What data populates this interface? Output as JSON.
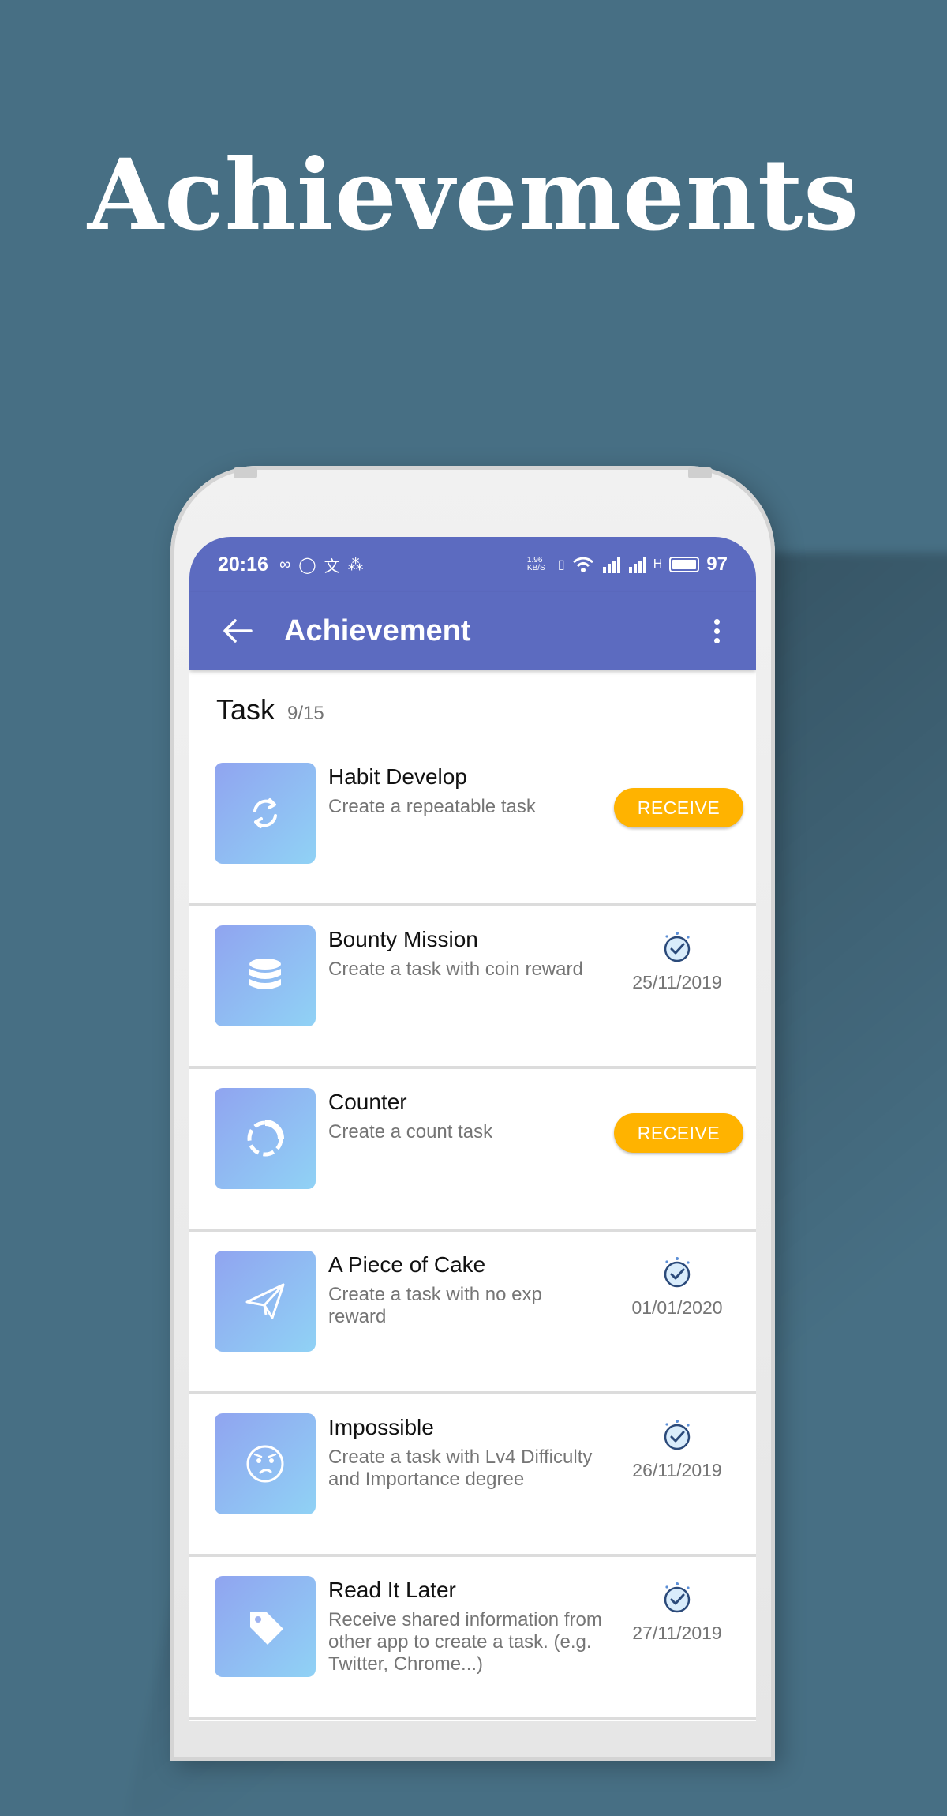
{
  "headline": "Achievements",
  "status_bar": {
    "time": "20:16",
    "net_speed": "1.96 KB/S",
    "battery": "97"
  },
  "app_bar": {
    "title": "Achievement"
  },
  "section": {
    "label": "Task",
    "count": "9/15"
  },
  "colors": {
    "background": "#476f84",
    "accent": "#5c6bc0",
    "receive_button": "#ffb300"
  },
  "items": [
    {
      "name": "Habit Develop",
      "desc": "Create a repeatable task",
      "action": "RECEIVE",
      "icon": "repeat-icon"
    },
    {
      "name": "Bounty Mission",
      "desc": "Create a task with coin reward",
      "date": "25/11/2019",
      "icon": "coins-icon"
    },
    {
      "name": "Counter",
      "desc": "Create a count task",
      "action": "RECEIVE",
      "icon": "counter-ring-icon"
    },
    {
      "name": "A Piece of Cake",
      "desc": "Create a task with no exp reward",
      "date": "01/01/2020",
      "icon": "paper-plane-icon"
    },
    {
      "name": "Impossible",
      "desc": "Create a task with Lv4 Difficulty and Importance degree",
      "date": "26/11/2019",
      "icon": "worried-face-icon"
    },
    {
      "name": "Read It Later",
      "desc": "Receive shared information from other app to create a task. (e.g. Twitter, Chrome...)",
      "date": "27/11/2019",
      "icon": "tag-icon"
    }
  ]
}
